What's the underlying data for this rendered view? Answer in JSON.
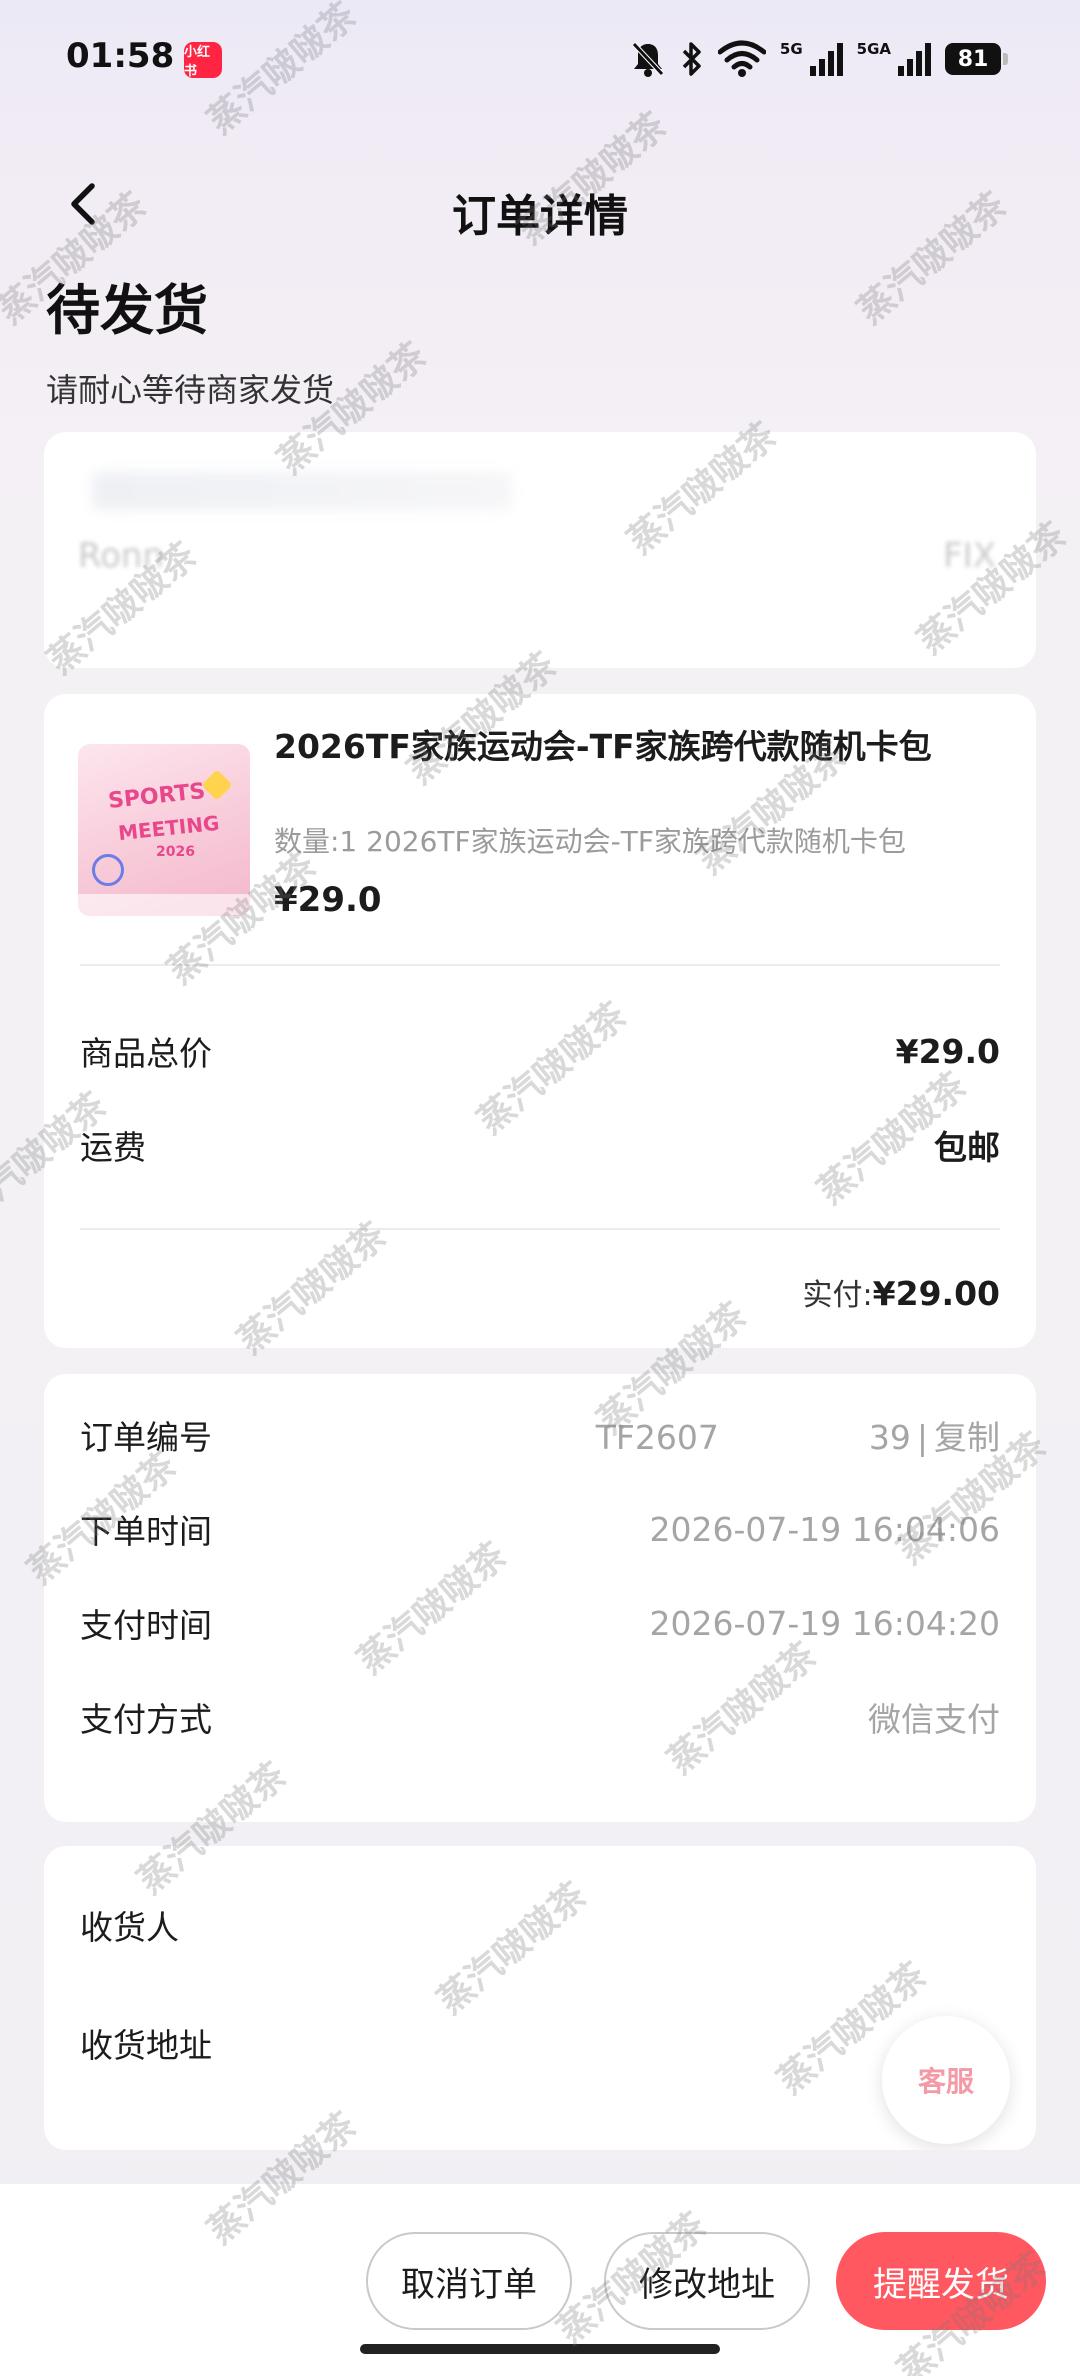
{
  "status_bar": {
    "time": "01:58",
    "app_badge": "小红书",
    "signal_label_1": "5G",
    "signal_label_2": "5GA",
    "battery": "81"
  },
  "nav": {
    "title": "订单详情"
  },
  "order_status": {
    "title": "待发货",
    "subtitle": "请耐心等待商家发货"
  },
  "blurred_card": {
    "left_text": "Ronn",
    "right_text": "FIX"
  },
  "product": {
    "name": "2026TF家族运动会-TF家族跨代款随机卡包",
    "description": "数量:1 2026TF家族运动会-TF家族跨代款随机卡包",
    "price": "¥29.0",
    "thumb_text_1": "SPORTS",
    "thumb_text_2": "MEETING",
    "thumb_text_3": "2026"
  },
  "summary": {
    "total_label": "商品总价",
    "total_value": "¥29.0",
    "shipping_label": "运费",
    "shipping_value": "包邮",
    "paid_label": "实付:",
    "paid_value": "¥29.00"
  },
  "order_info": {
    "order_no_label": "订单编号",
    "order_no_value": "TF2607",
    "order_no_value_tail": "39",
    "copy_label": "复制",
    "separator": "|",
    "order_time_label": "下单时间",
    "order_time_value": "2026-07-19 16:04:06",
    "pay_time_label": "支付时间",
    "pay_time_value": "2026-07-19 16:04:20",
    "pay_method_label": "支付方式",
    "pay_method_value": "微信支付"
  },
  "address": {
    "receiver_label": "收货人",
    "address_label": "收货地址",
    "customer_service": "客服"
  },
  "actions": {
    "cancel_order": "取消订单",
    "modify_address": "修改地址",
    "remind_shipping": "提醒发货"
  },
  "watermark": {
    "text": "蒸汽啵啵茶"
  },
  "colors": {
    "accent": "#ff5860",
    "brand_badge": "#ff2442",
    "muted_text": "#a5a5a5"
  }
}
